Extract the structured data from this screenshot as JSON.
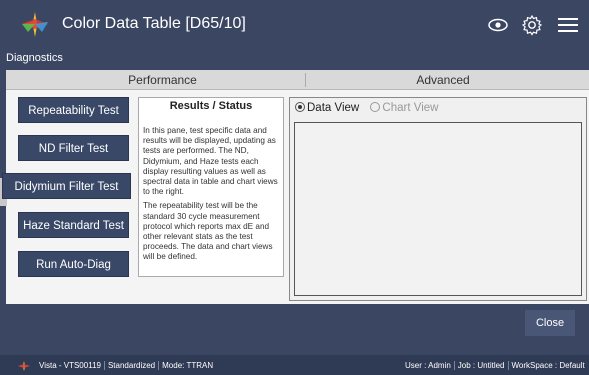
{
  "header": {
    "title": "Color Data Table [D65/10]",
    "subtitle": "Diagnostics",
    "icons": [
      "eye-icon",
      "gear-icon",
      "hamburger-menu-icon"
    ]
  },
  "tabs": [
    {
      "label": "Performance",
      "active": true
    },
    {
      "label": "Advanced",
      "active": false
    }
  ],
  "tests": {
    "repeatability": "Repeatability Test",
    "nd_filter": "ND Filter Test",
    "didymium": "Didymium Filter Test",
    "haze": "Haze Standard Test",
    "auto_diag": "Run Auto-Diag"
  },
  "results": {
    "title": "Results / Status",
    "para1": "In this pane, test specific data and results will be displayed, updating as tests are performed. The ND, Didymium, and Haze tests each display resulting values as well as spectral data in table and chart views to the right.",
    "para2": "The repeatability test will be the standard 30 cycle measurement protocol which reports max dE and other relevant stats as the test proceeds. The data and chart views will be defined."
  },
  "view": {
    "data_view": "Data View",
    "chart_view": "Chart View",
    "selected": "Data View"
  },
  "footer": {
    "close": "Close"
  },
  "status": {
    "device": "Vista - VTS00119",
    "state": "Standardized",
    "mode": "Mode: TTRAN",
    "user": "User : Admin",
    "job": "Job : Untitled",
    "workspace": "WorkSpace : Default"
  },
  "colors": {
    "chrome": "#3b4663",
    "button": "#3a4868",
    "panel": "#f4f4f4"
  }
}
